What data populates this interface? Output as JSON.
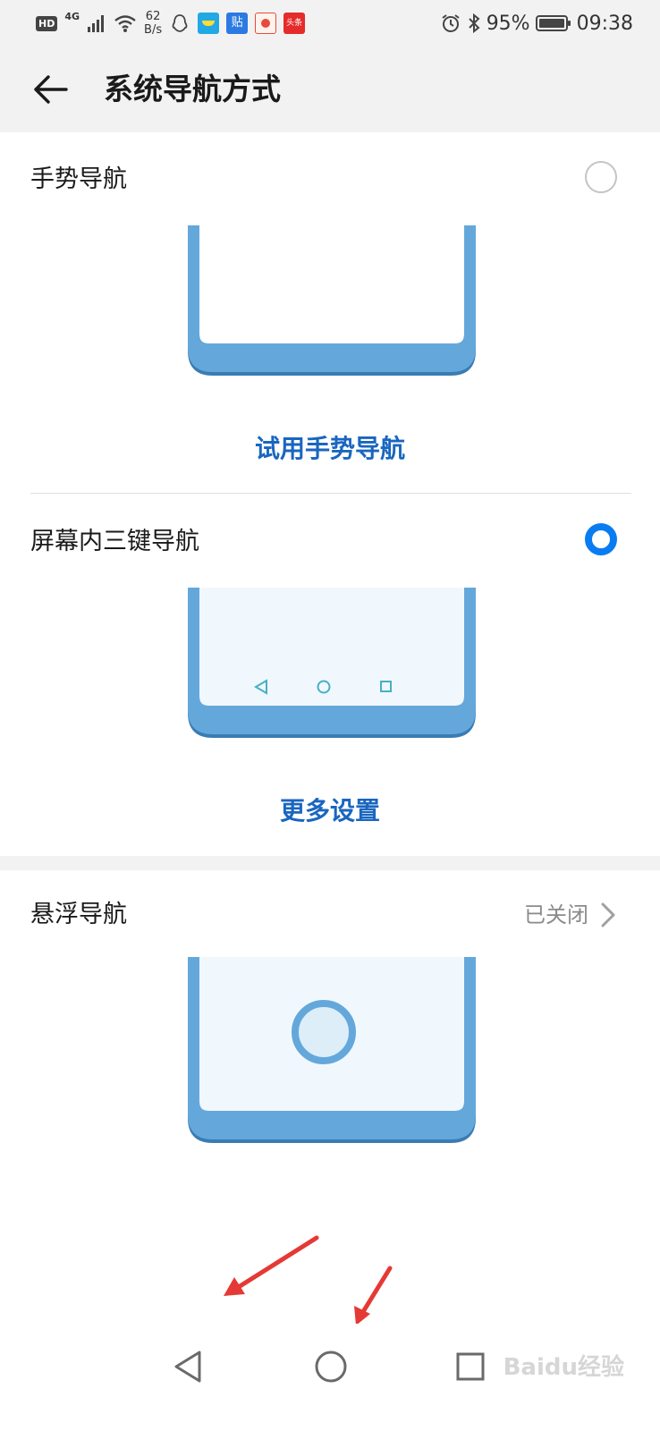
{
  "status_bar": {
    "hd": "HD",
    "network_type": "4G",
    "speed_value": "62",
    "speed_unit": "B/s",
    "battery": "95%",
    "time": "09:38",
    "app_icons": [
      {
        "name": "qq-icon",
        "color": "#ffffff"
      },
      {
        "name": "kids-app-icon",
        "color": "#22a9e5"
      },
      {
        "name": "tieba-icon",
        "color": "#2a7ae2",
        "text": "贴"
      },
      {
        "name": "mascot-app-icon",
        "color": "#e84b3a"
      },
      {
        "name": "toutiao-icon",
        "color": "#e62b2b",
        "text": "头条"
      }
    ]
  },
  "header": {
    "title": "系统导航方式",
    "back_icon": "arrow-left-icon"
  },
  "options": {
    "gesture": {
      "label": "手势导航",
      "selected": false,
      "action": "试用手势导航"
    },
    "three_key": {
      "label": "屏幕内三键导航",
      "selected": true,
      "action": "更多设置"
    },
    "floating": {
      "label": "悬浮导航",
      "status": "已关闭"
    }
  },
  "colors": {
    "accent": "#0a7cf2",
    "link": "#1a66c0",
    "phone_frame": "#64a8db",
    "phone_frame_dark": "#3b7bb3",
    "screen": "#f1f8fd",
    "annotation_arrow": "#e53935"
  },
  "watermark": "Baidu经验"
}
